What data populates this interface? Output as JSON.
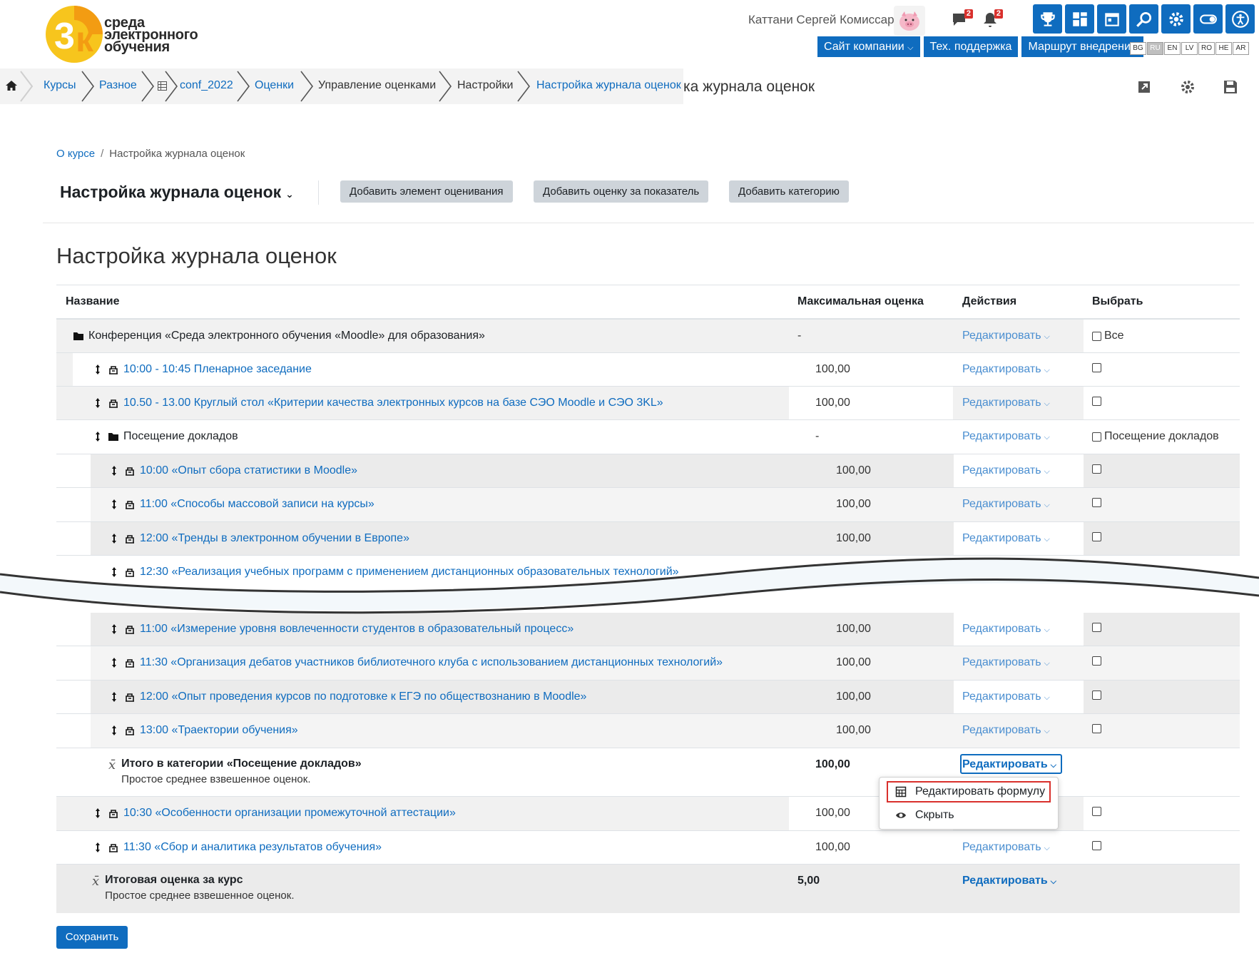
{
  "brand": {
    "logo_mark": "3K",
    "logo_lines": [
      "среда",
      "электронного",
      "обучения"
    ],
    "colors": {
      "orange": "#f39c12",
      "yellow": "#f7c51d",
      "blue": "#0f6cbf"
    }
  },
  "header": {
    "user_name": "Каттани Сергей Комиссарович",
    "messages_count": "2",
    "notifications_count": "2",
    "tool_icons": [
      "trophy-icon",
      "dashboard-icon",
      "calendar-icon",
      "search-icon",
      "gear-icon",
      "toggle-icon",
      "accessibility-icon"
    ],
    "links": [
      "Сайт компании",
      "Тех. поддержка",
      "Маршрут внедрения"
    ],
    "languages": [
      "BG",
      "RU",
      "EN",
      "LV",
      "RO",
      "HE",
      "AR"
    ],
    "active_language": "RU"
  },
  "breadcrumb": {
    "items": [
      "Курсы",
      "Разное",
      "conf_2022",
      "Оценки",
      "Управление оценками",
      "Настройки",
      "Настройка журнала оценок"
    ],
    "overflow_text": "ка журнала оценок"
  },
  "sub_breadcrumb": {
    "link": "О курсе",
    "separator": "/",
    "current": "Настройка журнала оценок"
  },
  "toolbar": {
    "title": "Настройка журнала оценок",
    "buttons": [
      "Добавить элемент оценивания",
      "Добавить оценку за показатель",
      "Добавить категорию"
    ]
  },
  "page_title": "Настройка журнала оценок",
  "table": {
    "headers": {
      "name": "Название",
      "max": "Максимальная оценка",
      "actions": "Действия",
      "select": "Выбрать"
    },
    "edit_label": "Редактировать",
    "rows": [
      {
        "name": "Конференция «Среда электронного обучения «Moodle» для образования»",
        "max": "-",
        "select": "Все"
      },
      {
        "name": "10:00 - 10:45 Пленарное заседание",
        "max": "100,00"
      },
      {
        "name": "10.50 - 13.00 Круглый стол «Критерии качества электронных курсов на базе СЭО Moodle и СЭО 3KL»",
        "max": "100,00"
      },
      {
        "name": "Посещение докладов",
        "max": "-",
        "select": "Посещение докладов"
      },
      {
        "name": "10:00 «Опыт сбора статистики в Moodle»",
        "max": "100,00"
      },
      {
        "name": "11:00 «Способы массовой записи на курсы»",
        "max": "100,00"
      },
      {
        "name": "12:00 «Тренды в электронном обучении в Европе»",
        "max": "100,00"
      },
      {
        "name": "12:30 «Реализация учебных программ с применением дистанционных образовательных технологий»",
        "max": ""
      },
      {
        "name": "11:00 «Измерение уровня вовлеченности студентов в образовательный процесс»",
        "max": "100,00"
      },
      {
        "name": "11:30 «Организация дебатов участников библиотечного клуба с использованием дистанционных технологий»",
        "max": "100,00"
      },
      {
        "name": "12:00 «Опыт проведения курсов по подготовке к ЕГЭ по обществознанию в Moodle»",
        "max": "100,00"
      },
      {
        "name": "13:00 «Траектории обучения»",
        "max": "100,00"
      },
      {
        "name": "Итого в категории «Посещение докладов»",
        "desc": "Простое среднее взвешенное оценок.",
        "max": "100,00"
      },
      {
        "name": "10:30 «Особенности организации промежуточной аттестации»",
        "max": "100,00"
      },
      {
        "name": "11:30 «Сбор и аналитика результатов обучения»",
        "max": "100,00"
      },
      {
        "name": "Итоговая оценка за курс",
        "desc": "Простое среднее взвешенное оценок.",
        "max": "5,00"
      }
    ]
  },
  "dropdown": {
    "items": [
      "Редактировать формулу",
      "Скрыть"
    ]
  },
  "save_label": "Сохранить"
}
